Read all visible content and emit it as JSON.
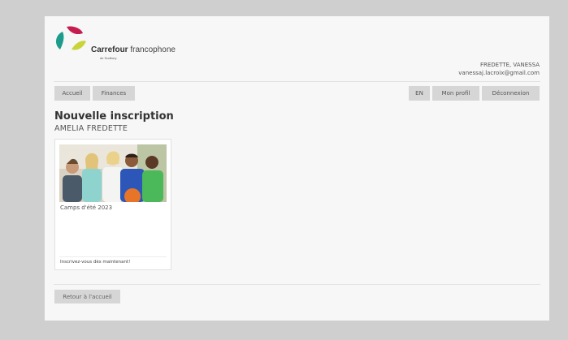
{
  "brand": {
    "name_bold": "Carrefour",
    "name_rest": "francophone",
    "subline": "de Sudbury",
    "colors": {
      "magenta": "#c51d4f",
      "teal": "#1d9b8c",
      "lime": "#c8d43a"
    }
  },
  "user": {
    "name": "FREDETTE, VANESSA",
    "email": "vanessaj.lacroix@gmail.com"
  },
  "nav": {
    "home": "Accueil",
    "finances": "Finances",
    "lang": "EN",
    "profile": "Mon profil",
    "logout": "Déconnexion"
  },
  "page": {
    "title": "Nouvelle inscription",
    "subtitle": "AMELIA FREDETTE"
  },
  "programs": [
    {
      "name": "Camps d'été 2023",
      "footer": "Inscrivez-vous dès maintenant!",
      "image": "children-group-photo"
    }
  ],
  "back_button": "Retour à l'accueil"
}
